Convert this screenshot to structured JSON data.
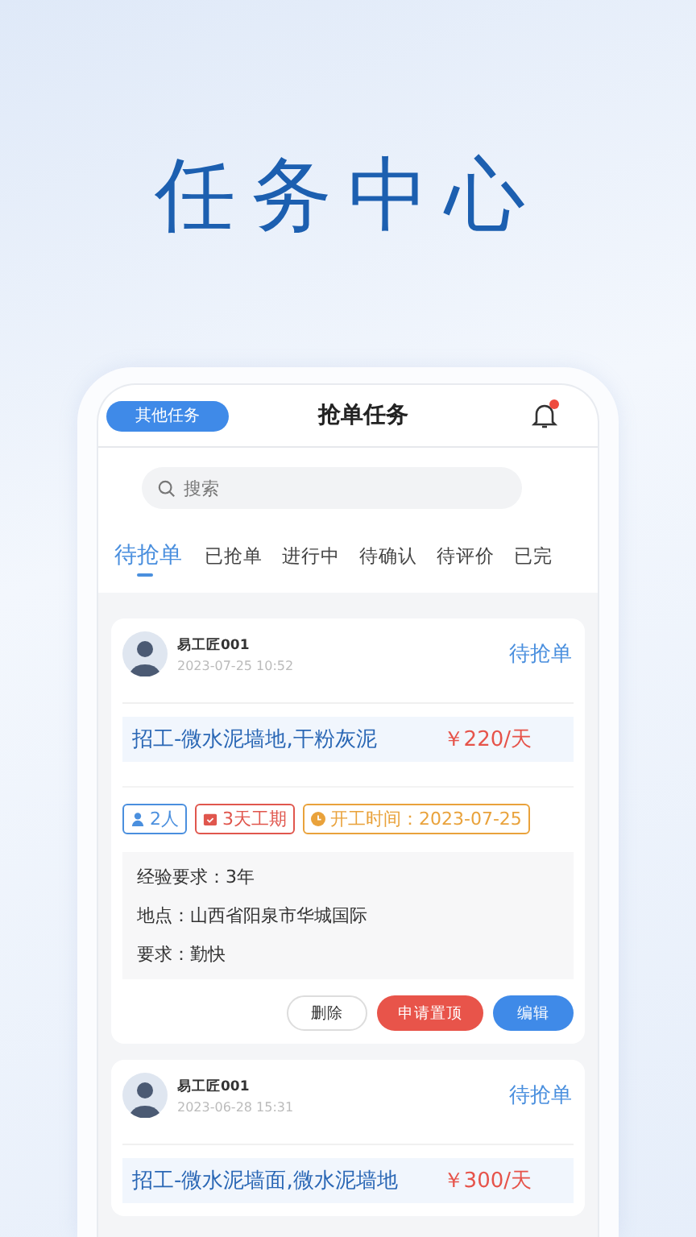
{
  "hero_title": "任务中心",
  "header": {
    "left_button": "其他任务",
    "title": "抢单任务",
    "has_notification": true
  },
  "search": {
    "placeholder": "搜索"
  },
  "tabs": [
    {
      "label": "待抢单",
      "selected": true
    },
    {
      "label": "已抢单",
      "selected": false
    },
    {
      "label": "进行中",
      "selected": false
    },
    {
      "label": "待确认",
      "selected": false
    },
    {
      "label": "待评价",
      "selected": false
    },
    {
      "label": "已完",
      "selected": false
    }
  ],
  "tasks": [
    {
      "user": "易工匠001",
      "time": "2023-07-25 10:52",
      "status": "待抢单",
      "title": "招工-微水泥墙地,干粉灰泥",
      "price": "￥220/天",
      "tags": [
        {
          "kind": "people",
          "text": "2人"
        },
        {
          "kind": "duration",
          "text": "3天工期"
        },
        {
          "kind": "start",
          "text": "开工时间：2023-07-25"
        }
      ],
      "details": [
        "经验要求：3年",
        "地点：山西省阳泉市华城国际",
        "要求：勤快"
      ],
      "actions": [
        {
          "kind": "delete",
          "label": "删除"
        },
        {
          "kind": "top",
          "label": "申请置顶"
        },
        {
          "kind": "edit",
          "label": "编辑"
        }
      ]
    },
    {
      "user": "易工匠001",
      "time": "2023-06-28 15:31",
      "status": "待抢单",
      "title": "招工-微水泥墙面,微水泥墙地",
      "price": "￥300/天"
    }
  ]
}
